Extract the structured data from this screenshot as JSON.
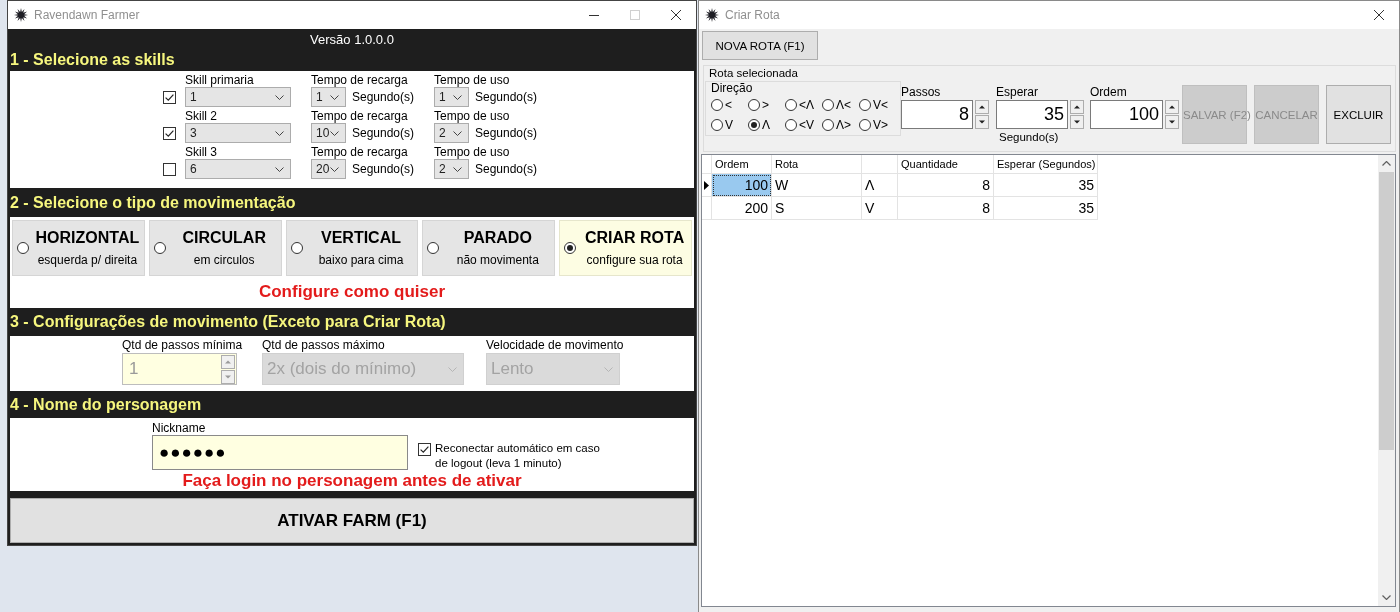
{
  "main_window": {
    "title": "Ravendawn Farmer",
    "version": "Versão 1.0.0.0"
  },
  "skills_section": {
    "title": "1 - Selecione as skills",
    "rows": [
      {
        "checked": true,
        "skill_label": "Skill primaria",
        "skill": "1",
        "cooldown_label": "Tempo de recarga",
        "cooldown": "1",
        "cooldown_unit": "Segundo(s)",
        "use_label": "Tempo de uso",
        "use": "1",
        "use_unit": "Segundo(s)"
      },
      {
        "checked": true,
        "skill_label": "Skill 2",
        "skill": "3",
        "cooldown_label": "Tempo de recarga",
        "cooldown": "10",
        "cooldown_unit": "Segundo(s)",
        "use_label": "Tempo de uso",
        "use": "2",
        "use_unit": "Segundo(s)"
      },
      {
        "checked": false,
        "skill_label": "Skill 3",
        "skill": "6",
        "cooldown_label": "Tempo de recarga",
        "cooldown": "20",
        "cooldown_unit": "Segundo(s)",
        "use_label": "Tempo de uso",
        "use": "2",
        "use_unit": "Segundo(s)"
      }
    ]
  },
  "movement_section": {
    "title": "2 - Selecione o tipo de movimentação",
    "options": [
      {
        "title": "HORIZONTAL",
        "subtitle": "esquerda p/ direita",
        "selected": false
      },
      {
        "title": "CIRCULAR",
        "subtitle": "em circulos",
        "selected": false
      },
      {
        "title": "VERTICAL",
        "subtitle": "baixo para cima",
        "selected": false
      },
      {
        "title": "PARADO",
        "subtitle": "não movimenta",
        "selected": false
      },
      {
        "title": "CRIAR ROTA",
        "subtitle": "configure sua rota",
        "selected": true
      }
    ],
    "note": "Configure como quiser"
  },
  "movement_settings": {
    "title": "3 - Configurações de movimento (Exceto para Criar Rota)",
    "fields": [
      {
        "kind": "spinner",
        "label": "Qtd de passos mínima",
        "value": "1",
        "disabled": true
      },
      {
        "kind": "dropdown",
        "label": "Qtd de passos máximo",
        "value": "2x (dois do mínimo)",
        "disabled": true
      },
      {
        "kind": "dropdown",
        "label": "Velocidade de movimento",
        "value": "Lento",
        "disabled": true
      }
    ]
  },
  "character_section": {
    "title": "4 - Nome do personagem",
    "nickname": {
      "label": "Nickname",
      "value": "●●●●●●"
    },
    "reconnect": {
      "label": "Reconectar automático em caso de logout (leva 1 minuto)",
      "checked": true
    },
    "note": "Faça login no personagem antes de ativar"
  },
  "activate_button": {
    "label": "ATIVAR FARM (F1)"
  },
  "route_window": {
    "title": "Criar Rota",
    "new_route_button": "NOVA ROTA (F1)",
    "selected_route": {
      "title": "Rota selecionada",
      "direction": {
        "label": "Direção",
        "options": [
          {
            "label": "<",
            "selected": false
          },
          {
            "label": ">",
            "selected": false
          },
          {
            "label": "<Λ",
            "selected": false
          },
          {
            "label": "Λ<",
            "selected": false
          },
          {
            "label": "V<",
            "selected": false
          },
          {
            "label": "V",
            "selected": false
          },
          {
            "label": "Λ",
            "selected": true
          },
          {
            "label": "<V",
            "selected": false
          },
          {
            "label": "Λ>",
            "selected": false
          },
          {
            "label": "V>",
            "selected": false
          }
        ]
      },
      "fields": [
        {
          "label": "Passos",
          "value": "8"
        },
        {
          "label": "Esperar",
          "value": "35",
          "unit": "Segundo(s)"
        },
        {
          "label": "Ordem",
          "value": "100"
        }
      ],
      "buttons": [
        {
          "label": "SALVAR (F2)",
          "disabled": true
        },
        {
          "label": "CANCELAR",
          "disabled": true
        },
        {
          "label": "EXCLUIR",
          "disabled": false
        }
      ]
    },
    "table": {
      "columns": [
        "Ordem",
        "Rota",
        null,
        "Quantidade",
        "Esperar (Segundos)"
      ],
      "rows": [
        {
          "selected": true,
          "cells": [
            "100",
            "W",
            "Λ",
            "8",
            "35"
          ]
        },
        {
          "selected": false,
          "cells": [
            "200",
            "S",
            "V",
            "8",
            "35"
          ]
        }
      ]
    }
  }
}
